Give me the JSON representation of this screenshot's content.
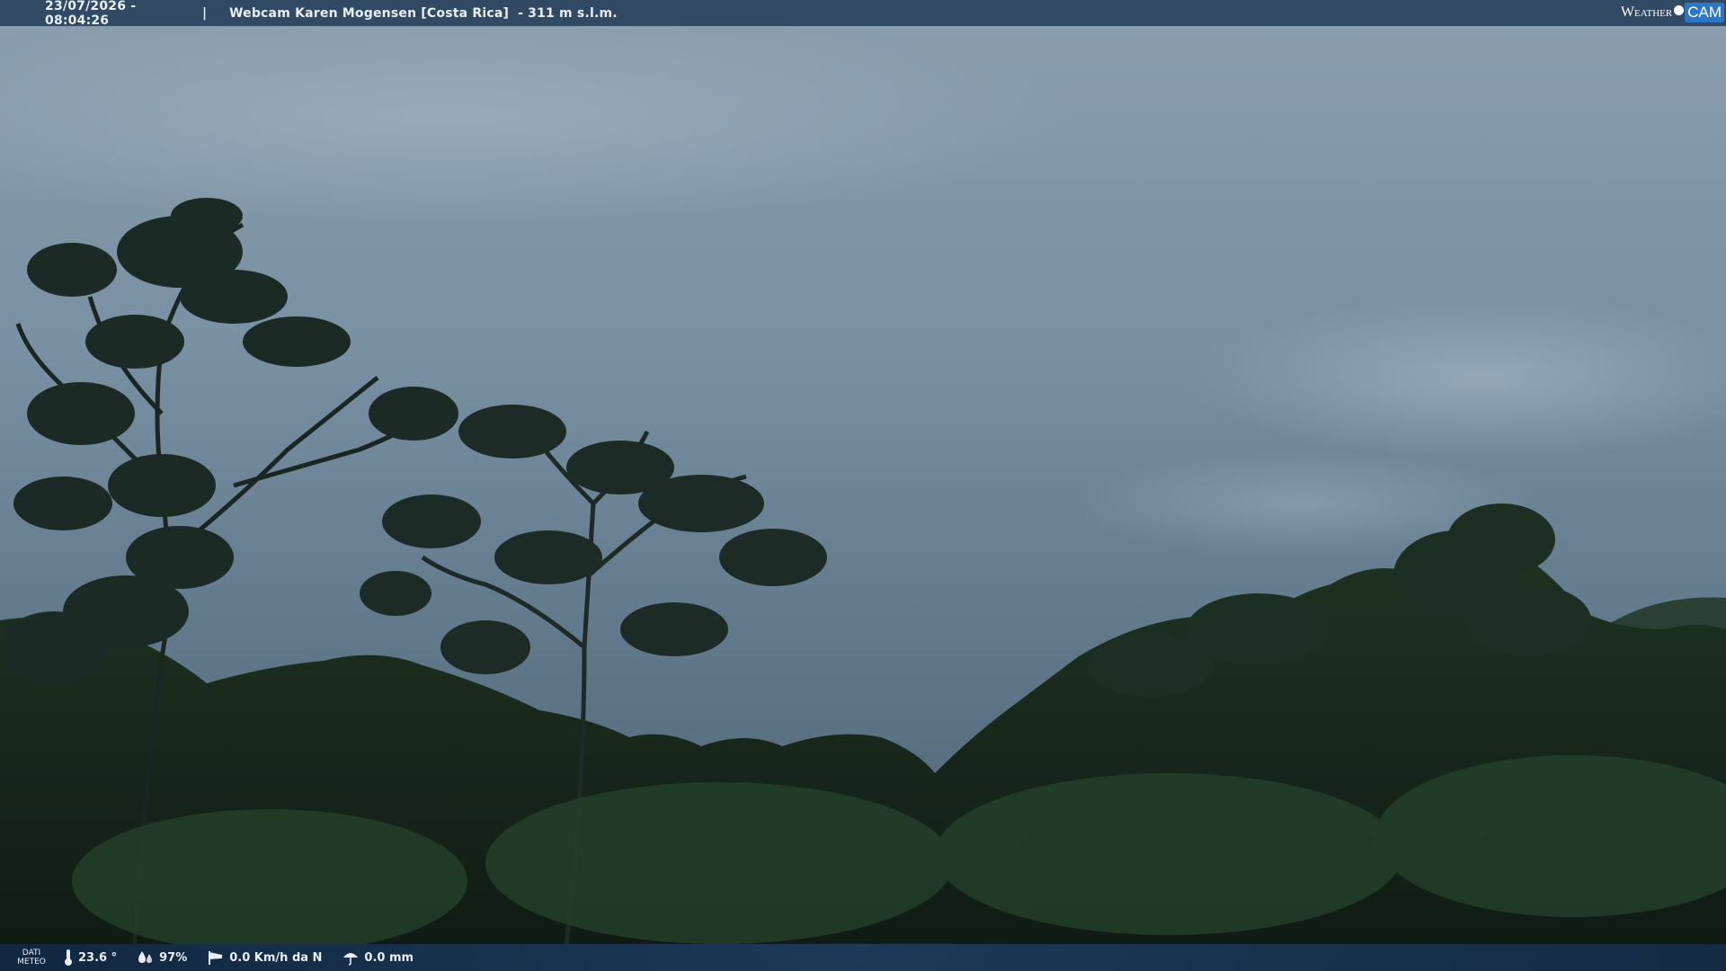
{
  "header": {
    "datetime": "23/07/2026 - 08:04:26",
    "separator": "|",
    "title": "Webcam Karen Mogensen [Costa Rica]",
    "altitude": "- 311 m s.l.m."
  },
  "logo": {
    "weather": "Weather",
    "cam": "CAM"
  },
  "footer": {
    "dati_line1": "DATI",
    "dati_line2": "METEO",
    "temperature": "23.6 °",
    "humidity": "97%",
    "wind": "0.0 Km/h da N",
    "rain": "0.0 mm"
  },
  "icons": {
    "temperature": "thermometer-icon",
    "humidity": "drops-icon",
    "wind": "windsock-icon",
    "rain": "umbrella-icon"
  },
  "colors": {
    "bar": "#2a425c",
    "sky": "#6f8597",
    "forest": "#16241a",
    "logo_accent": "#2b77c6"
  }
}
